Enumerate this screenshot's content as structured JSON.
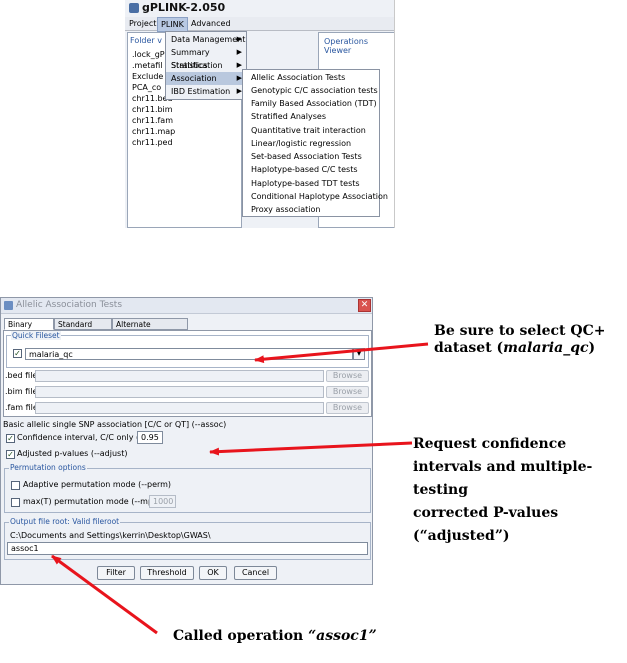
{
  "top_window": {
    "title": "gPLINK-2.050",
    "menubar": [
      "Project",
      "PLINK",
      "Advanced"
    ],
    "folder_panel_title": "Folder v",
    "files": [
      ".lock_gP",
      ".metafil",
      "Exclude",
      "PCA_co",
      "chr11.bed",
      "chr11.bim",
      "chr11.fam",
      "chr11.map",
      "chr11.ped"
    ],
    "ops_panel_title": "Operations Viewer",
    "plink_menu": [
      "Data Management",
      "Summary Statistics",
      "Stratification",
      "Association",
      "IBD Estimation"
    ],
    "association_menu": [
      "Allelic Association Tests",
      "Genotypic C/C association tests",
      "Family Based Association (TDT)",
      "Stratified Analyses",
      "Quantitative trait interaction",
      "Linear/logistic regression",
      "Set-based Association Tests",
      "Haplotype-based C/C tests",
      "Haplotype-based TDT tests",
      "Conditional Haplotype Association",
      "Proxy association"
    ]
  },
  "dialog": {
    "title": "Allelic Association Tests",
    "close_glyph": "✕",
    "tabs": [
      "Binary Input",
      "Standard Input",
      "Alternate Phenotype"
    ],
    "quick_fileset": {
      "title": "Quick Fileset",
      "value": "malaria_qc",
      "dropdown_glyph": "▾"
    },
    "file_rows": [
      {
        "label": ".bed file",
        "button": "Browse"
      },
      {
        "label": ".bim file",
        "button": "Browse"
      },
      {
        "label": ".fam file",
        "button": "Browse"
      }
    ],
    "basic_assoc_label": "Basic allelic single SNP association [C/C or QT] (--assoc)",
    "ci_label": "Confidence interval, C/C only (--ci)",
    "ci_value": "0.95",
    "adjust_label": "Adjusted p-values (--adjust)",
    "check_glyph": "✓",
    "permutation": {
      "title": "Permutation options",
      "adaptive_label": "Adaptive permutation mode (--perm)",
      "maxt_label": "max(T) permutation mode (--mperm)",
      "maxt_value": "1000"
    },
    "output": {
      "title": "Output file root: Valid fileroot",
      "path": "C:\\Documents and Settings\\kerrin\\Desktop\\GWAS\\",
      "value": "assoc1"
    },
    "buttons": {
      "filter": "Filter",
      "threshold": "Threshold",
      "ok": "OK",
      "cancel": "Cancel"
    }
  },
  "annotations": {
    "qc_line1": "Be sure to select QC+",
    "qc_line2_pre": "dataset (",
    "qc_line2_em": "malaria_qc",
    "qc_line2_post": ")",
    "ci_line1": "Request confidence",
    "ci_line2": "intervals and multiple-",
    "ci_line3": "testing",
    "ci_line4": "corrected P-values",
    "ci_line5": "(“adjusted”)",
    "op_pre": "Called operation ",
    "op_em": "“assoc1”"
  },
  "colors": {
    "arrow": "#e8141c",
    "menu_highlight": "#b9c8de",
    "group_title": "#2a57a0"
  }
}
